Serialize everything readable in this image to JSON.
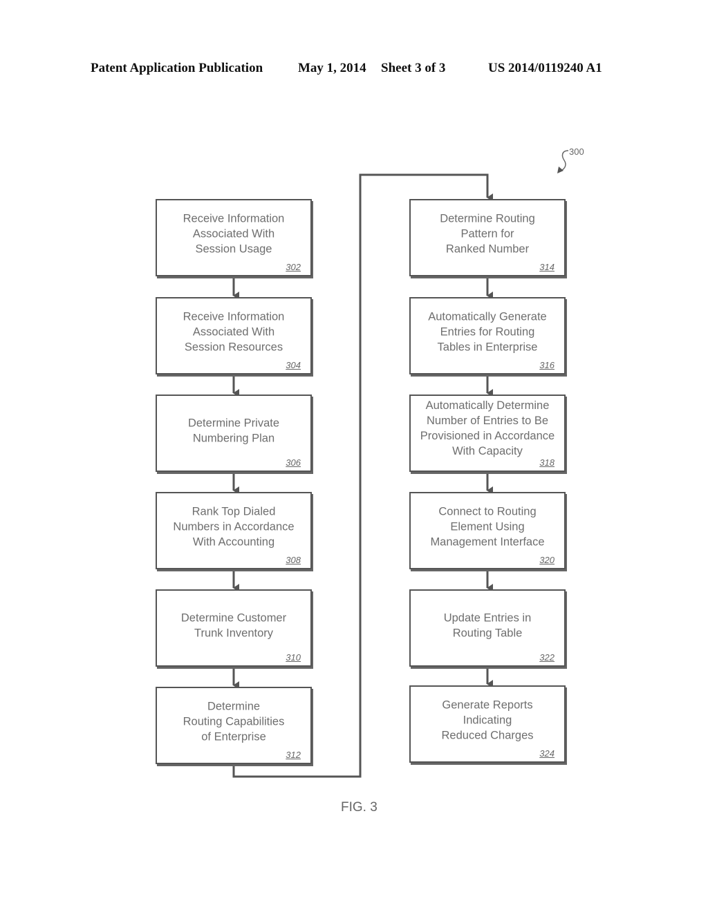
{
  "header": {
    "publication_type": "Patent Application Publication",
    "date": "May 1, 2014",
    "sheet": "Sheet 3 of 3",
    "publication_number": "US 2014/0119240 A1"
  },
  "diagram": {
    "reference_number": "300",
    "figure_label": "FIG. 3",
    "left_column": [
      {
        "ref": "302",
        "text": "Receive Information\nAssociated With\nSession Usage"
      },
      {
        "ref": "304",
        "text": "Receive Information\nAssociated With\nSession Resources"
      },
      {
        "ref": "306",
        "text": "Determine Private\nNumbering Plan"
      },
      {
        "ref": "308",
        "text": "Rank Top Dialed\nNumbers in Accordance\nWith Accounting"
      },
      {
        "ref": "310",
        "text": "Determine Customer\nTrunk Inventory"
      },
      {
        "ref": "312",
        "text": "Determine\nRouting Capabilities\nof Enterprise"
      }
    ],
    "right_column": [
      {
        "ref": "314",
        "text": "Determine Routing\nPattern for\nRanked Number"
      },
      {
        "ref": "316",
        "text": "Automatically Generate\nEntries for Routing\nTables in Enterprise"
      },
      {
        "ref": "318",
        "text": "Automatically Determine\nNumber of Entries to Be\nProvisioned in Accordance\nWith Capacity"
      },
      {
        "ref": "320",
        "text": "Connect to Routing\nElement Using\nManagement Interface"
      },
      {
        "ref": "322",
        "text": "Update Entries in\nRouting Table"
      },
      {
        "ref": "324",
        "text": "Generate Reports\nIndicating\nReduced Charges"
      }
    ]
  }
}
